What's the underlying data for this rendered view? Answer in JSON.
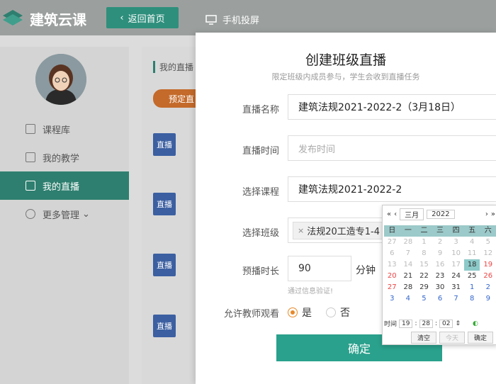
{
  "header": {
    "brand": "建筑云课",
    "back_label": "返回首页",
    "cast_label": "手机投屏"
  },
  "sidebar": {
    "items": [
      {
        "label": "课程库",
        "icon": "cube-icon"
      },
      {
        "label": "我的教学",
        "icon": "book-icon"
      },
      {
        "label": "我的直播",
        "icon": "camera-icon",
        "active": true
      },
      {
        "label": "更多管理",
        "icon": "more-icon"
      }
    ]
  },
  "content": {
    "title": "我的直播",
    "tab": "预定直",
    "badge": "直播"
  },
  "modal": {
    "title": "创建班级直播",
    "subtitle": "限定班级内成员参与，学生会收到直播任务",
    "name_label": "直播名称",
    "name_value": "建筑法规2021-2022-2（3月18日）",
    "time_label": "直播时间",
    "time_placeholder": "发布时间",
    "course_label": "选择课程",
    "course_value": "建筑法规2021-2022-2",
    "class_label": "选择班级",
    "class_tag": "法规20工造专1-4",
    "duration_label": "预播时长",
    "duration_value": "90",
    "duration_unit": "分钟",
    "duration_hint": "通过信息验证!",
    "allow_label": "允许教师观看",
    "yes": "是",
    "no": "否",
    "confirm": "确定"
  },
  "calendar": {
    "month": "三月",
    "year": "2022",
    "weekdays": [
      "日",
      "一",
      "二",
      "三",
      "四",
      "五",
      "六"
    ],
    "weeks": [
      [
        "27",
        "28",
        "1",
        "2",
        "3",
        "4",
        "5"
      ],
      [
        "6",
        "7",
        "8",
        "9",
        "10",
        "11",
        "12"
      ],
      [
        "13",
        "14",
        "15",
        "16",
        "17",
        "18",
        "19"
      ],
      [
        "20",
        "21",
        "22",
        "23",
        "24",
        "25",
        "26"
      ],
      [
        "27",
        "28",
        "29",
        "30",
        "31",
        "1",
        "2"
      ],
      [
        "3",
        "4",
        "5",
        "6",
        "7",
        "8",
        "9"
      ]
    ],
    "time_label": "时间",
    "hour": "19",
    "minute": "28",
    "second": "02",
    "clear": "清空",
    "today": "今天",
    "ok": "确定"
  },
  "colors": {
    "primary": "#2aa18c",
    "accent": "#e8892a"
  }
}
